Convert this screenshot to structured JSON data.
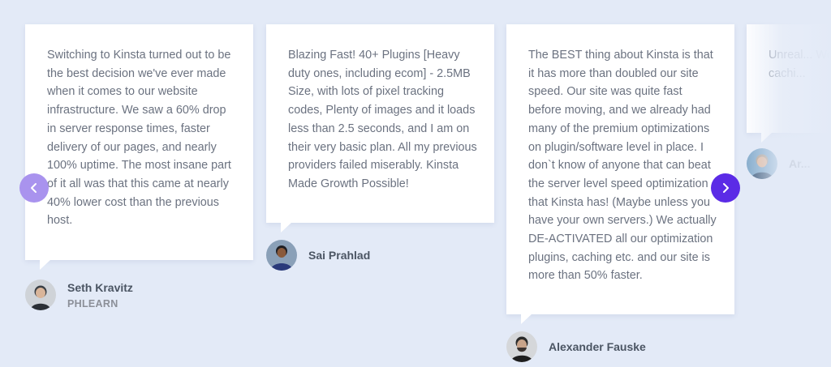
{
  "testimonials": [
    {
      "quote": "Switching to Kinsta turned out to be the best decision we've ever made when it comes to our website infrastructure. We saw a 60% drop in server response times, faster delivery of our pages, and nearly 100% uptime. The most insane part of it all was that this came at nearly 40% lower cost than the previous host.",
      "name": "Seth Kravitz",
      "company": "PHLEARN"
    },
    {
      "quote": "Blazing Fast! 40+ Plugins [Heavy duty ones, including ecom] - 2.5MB Size, with lots of pixel tracking codes, Plenty of images and it loads less than 2.5 seconds, and I am on their very basic plan. All my previous providers failed miserably. Kinsta Made Growth Possible!",
      "name": "Sai Prahlad"
    },
    {
      "quote": "The BEST thing about Kinsta is that it has more than doubled our site speed. Our site was quite fast before moving, and we already had many of the premium optimizations on plugin/software level in place. I don`t know of anyone that can beat the server level speed optimization that Kinsta has! (Maybe unless you have your own servers.) We actually DE-ACTIVATED all our optimization plugins, caching etc. and our site is more than 50% faster.",
      "name": "Alexander Fauske"
    },
    {
      "quote": "Unreal... WordP... cachi...",
      "name": "Ar..."
    }
  ],
  "nav": {
    "prev_icon": "chevron-left-icon",
    "next_icon": "chevron-right-icon"
  },
  "colors": {
    "background": "#e3eaf7",
    "card": "#ffffff",
    "prev_button": "#a993ee",
    "next_button": "#5b2be6",
    "quote_text": "#6b7280",
    "author_name": "#4b5563"
  }
}
